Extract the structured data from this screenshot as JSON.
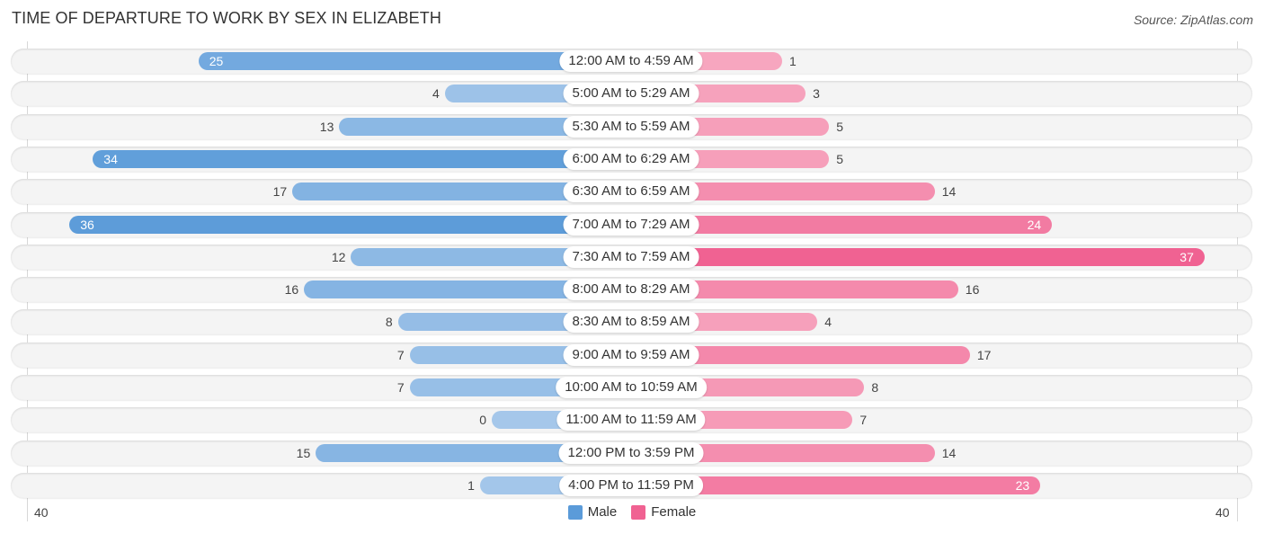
{
  "header": {
    "title": "TIME OF DEPARTURE TO WORK BY SEX IN ELIZABETH",
    "source": "Source: ZipAtlas.com"
  },
  "colors": {
    "male_strong": "#5b9bd9",
    "male_light": "#a5c7ea",
    "female_strong": "#f06292",
    "female_light": "#f7a8c0"
  },
  "chart_data": {
    "type": "bar",
    "orientation": "horizontal-diverging",
    "title": "TIME OF DEPARTURE TO WORK BY SEX IN ELIZABETH",
    "categories": [
      "12:00 AM to 4:59 AM",
      "5:00 AM to 5:29 AM",
      "5:30 AM to 5:59 AM",
      "6:00 AM to 6:29 AM",
      "6:30 AM to 6:59 AM",
      "7:00 AM to 7:29 AM",
      "7:30 AM to 7:59 AM",
      "8:00 AM to 8:29 AM",
      "8:30 AM to 8:59 AM",
      "9:00 AM to 9:59 AM",
      "10:00 AM to 10:59 AM",
      "11:00 AM to 11:59 AM",
      "12:00 PM to 3:59 PM",
      "4:00 PM to 11:59 PM"
    ],
    "series": [
      {
        "name": "Male",
        "values": [
          25,
          4,
          13,
          34,
          17,
          36,
          12,
          16,
          8,
          7,
          7,
          0,
          15,
          1
        ]
      },
      {
        "name": "Female",
        "values": [
          1,
          3,
          5,
          5,
          14,
          24,
          37,
          16,
          4,
          17,
          8,
          7,
          14,
          23
        ]
      }
    ],
    "axis_ticks": {
      "left": "40",
      "right": "40"
    },
    "xlim": [
      -40,
      40
    ],
    "legend": {
      "position": "bottom-center",
      "entries": [
        "Male",
        "Female"
      ]
    },
    "xlabel": "",
    "ylabel": ""
  }
}
